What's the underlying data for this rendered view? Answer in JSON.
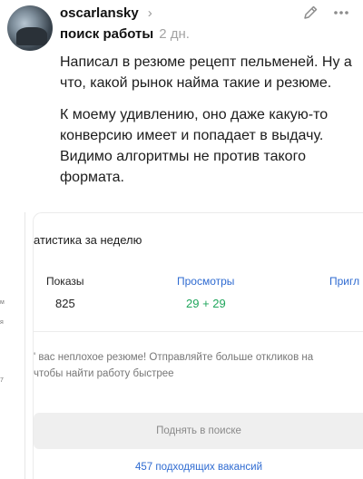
{
  "post": {
    "author": "oscarlansky",
    "author_chevron": "›",
    "topic": "поиск работы",
    "time": "2 дн.",
    "paragraphs": [
      "Написал в резюме рецепт пельменей. Ну а что, какой рынок найма такие и резюме.",
      "К моему удивлению, оно даже какую-то конверсию имеет и попадает в выдачу. Видимо алгоритмы не против такого формата."
    ],
    "icons": {
      "edit": "pencil-icon",
      "more": "more-dots-icon"
    }
  },
  "stats": {
    "title": "атистика за неделю",
    "items": [
      {
        "label": "Показы",
        "value": "825"
      },
      {
        "label": "Просмотры",
        "value": "29 + 29"
      },
      {
        "label": "Пригл",
        "value": ""
      }
    ],
    "message_lines": [
      "' вас неплохое резюме! Отправляйте больше откликов на",
      "чтобы найти работу быстрее"
    ],
    "raise_button": "Поднять в поиске",
    "vacancies_link": "457 подходящих вакансий"
  },
  "left_panel": {
    "marks": [
      "м",
      "я",
      "7"
    ]
  },
  "colors": {
    "link_blue": "#2f6bd1",
    "green": "#20a65c",
    "muted": "#a3a3a3"
  }
}
